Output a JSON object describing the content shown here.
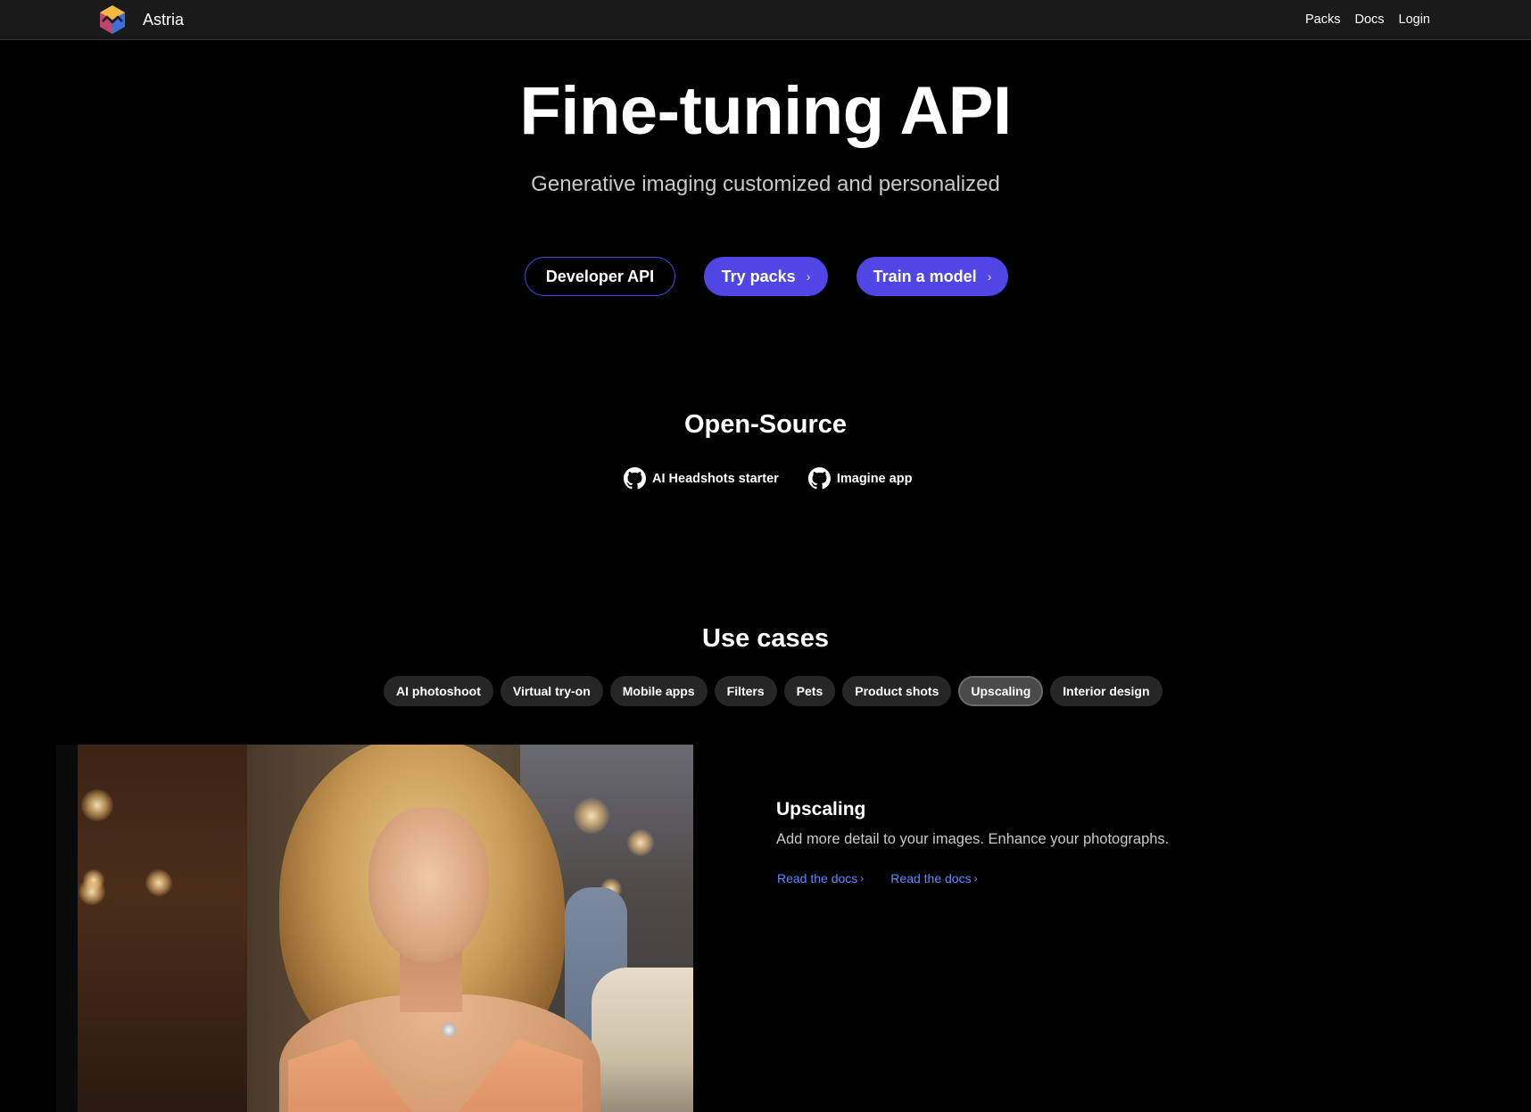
{
  "nav": {
    "brand": "Astria",
    "links": [
      {
        "label": "Packs"
      },
      {
        "label": "Docs"
      },
      {
        "label": "Login"
      }
    ]
  },
  "hero": {
    "title": "Fine-tuning API",
    "subtitle": "Generative imaging customized and personalized",
    "buttons": {
      "developer_api": "Developer API",
      "try_packs": "Try packs",
      "train_model": "Train a model"
    },
    "chevron": "›"
  },
  "open_source": {
    "heading": "Open-Source",
    "links": [
      {
        "label": "AI Headshots starter",
        "icon": "github-icon"
      },
      {
        "label": "Imagine app",
        "icon": "github-icon"
      }
    ]
  },
  "use_cases": {
    "heading": "Use cases",
    "tabs": [
      {
        "label": "AI photoshoot"
      },
      {
        "label": "Virtual try-on"
      },
      {
        "label": "Mobile apps"
      },
      {
        "label": "Filters"
      },
      {
        "label": "Pets"
      },
      {
        "label": "Product shots"
      },
      {
        "label": "Upscaling",
        "active": true
      },
      {
        "label": "Interior design"
      }
    ],
    "selected": {
      "title": "Upscaling",
      "description": "Add more detail to your images. Enhance your photographs.",
      "links": [
        {
          "label": "Read the docs"
        },
        {
          "label": "Read the docs"
        }
      ],
      "link_chevron": "›"
    }
  },
  "colors": {
    "background": "#000000",
    "nav_background": "#1a1a1a",
    "accent": "#4f46e5",
    "link": "#5b8cff",
    "tab_background": "#262626",
    "tab_active_background": "#4a4a4a",
    "muted_text": "#c9c9c9"
  }
}
